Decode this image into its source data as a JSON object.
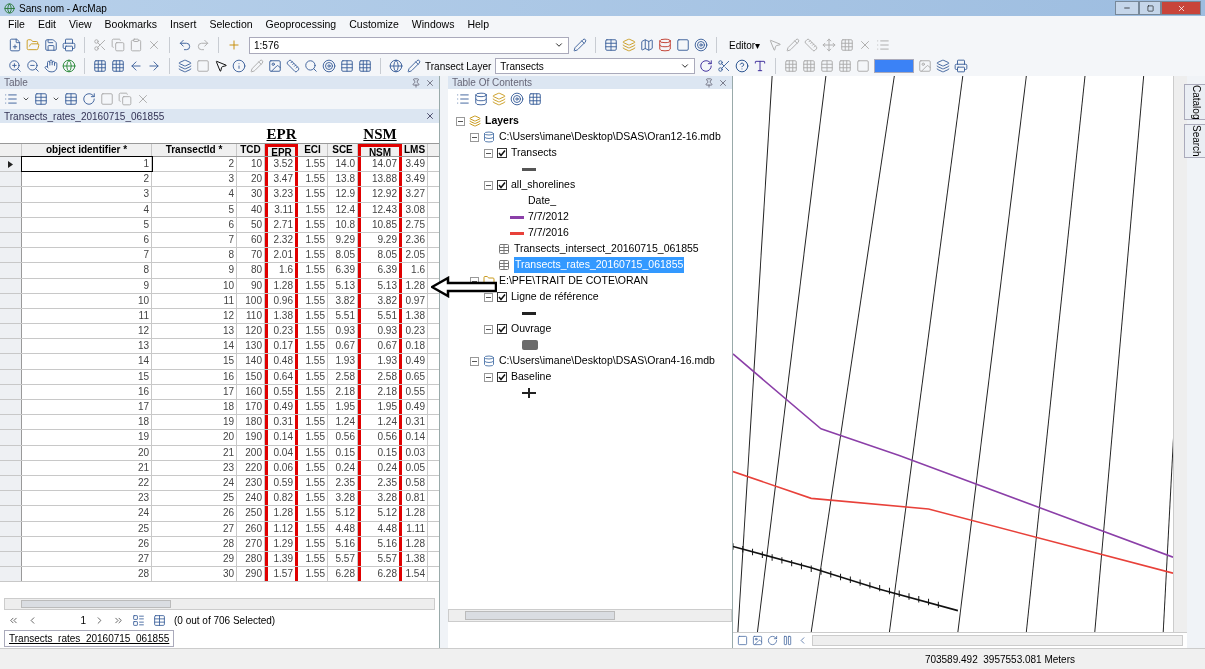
{
  "window": {
    "title": "Sans nom - ArcMap"
  },
  "menu": [
    "File",
    "Edit",
    "View",
    "Bookmarks",
    "Insert",
    "Selection",
    "Geoprocessing",
    "Customize",
    "Windows",
    "Help"
  ],
  "toolbar": {
    "scale": "1:576",
    "editor": "Editor▾",
    "transect_layer_label": "Transect Layer",
    "transect_layer_value": "Transects"
  },
  "table_panel": {
    "title": "Table",
    "table_name": "Transects_rates_20160715_061855",
    "columns": [
      {
        "label": "object identifier *",
        "highlighted": false
      },
      {
        "label": "TransectId *",
        "highlighted": false
      },
      {
        "label": "TCD",
        "highlighted": false
      },
      {
        "label": "EPR",
        "highlighted": true,
        "annotation": "EPR"
      },
      {
        "label": "ECI",
        "highlighted": false
      },
      {
        "label": "SCE",
        "highlighted": false
      },
      {
        "label": "NSM",
        "highlighted": true,
        "annotation": "NSM"
      },
      {
        "label": "LMS",
        "highlighted": false
      }
    ],
    "rows": [
      {
        "current": true,
        "cells": [
          "1",
          "2",
          "10",
          "3.52",
          "1.55",
          "14.0",
          "14.07",
          "3.49"
        ]
      },
      {
        "current": false,
        "cells": [
          "2",
          "3",
          "20",
          "3.47",
          "1.55",
          "13.8",
          "13.88",
          "3.49"
        ]
      },
      {
        "current": false,
        "cells": [
          "3",
          "4",
          "30",
          "3.23",
          "1.55",
          "12.9",
          "12.92",
          "3.27"
        ]
      },
      {
        "current": false,
        "cells": [
          "4",
          "5",
          "40",
          "3.11",
          "1.55",
          "12.4",
          "12.43",
          "3.08"
        ]
      },
      {
        "current": false,
        "cells": [
          "5",
          "6",
          "50",
          "2.71",
          "1.55",
          "10.8",
          "10.85",
          "2.75"
        ]
      },
      {
        "current": false,
        "cells": [
          "6",
          "7",
          "60",
          "2.32",
          "1.55",
          "9.29",
          "9.29",
          "2.36"
        ]
      },
      {
        "current": false,
        "cells": [
          "7",
          "8",
          "70",
          "2.01",
          "1.55",
          "8.05",
          "8.05",
          "2.05"
        ]
      },
      {
        "current": false,
        "cells": [
          "8",
          "9",
          "80",
          "1.6",
          "1.55",
          "6.39",
          "6.39",
          "1.6"
        ]
      },
      {
        "current": false,
        "cells": [
          "9",
          "10",
          "90",
          "1.28",
          "1.55",
          "5.13",
          "5.13",
          "1.28"
        ]
      },
      {
        "current": false,
        "cells": [
          "10",
          "11",
          "100",
          "0.96",
          "1.55",
          "3.82",
          "3.82",
          "0.97"
        ]
      },
      {
        "current": false,
        "cells": [
          "11",
          "12",
          "110",
          "1.38",
          "1.55",
          "5.51",
          "5.51",
          "1.38"
        ]
      },
      {
        "current": false,
        "cells": [
          "12",
          "13",
          "120",
          "0.23",
          "1.55",
          "0.93",
          "0.93",
          "0.23"
        ]
      },
      {
        "current": false,
        "cells": [
          "13",
          "14",
          "130",
          "0.17",
          "1.55",
          "0.67",
          "0.67",
          "0.18"
        ]
      },
      {
        "current": false,
        "cells": [
          "14",
          "15",
          "140",
          "0.48",
          "1.55",
          "1.93",
          "1.93",
          "0.49"
        ]
      },
      {
        "current": false,
        "cells": [
          "15",
          "16",
          "150",
          "0.64",
          "1.55",
          "2.58",
          "2.58",
          "0.65"
        ]
      },
      {
        "current": false,
        "cells": [
          "16",
          "17",
          "160",
          "0.55",
          "1.55",
          "2.18",
          "2.18",
          "0.55"
        ]
      },
      {
        "current": false,
        "cells": [
          "17",
          "18",
          "170",
          "0.49",
          "1.55",
          "1.95",
          "1.95",
          "0.49"
        ]
      },
      {
        "current": false,
        "cells": [
          "18",
          "19",
          "180",
          "0.31",
          "1.55",
          "1.24",
          "1.24",
          "0.31"
        ]
      },
      {
        "current": false,
        "cells": [
          "19",
          "20",
          "190",
          "0.14",
          "1.55",
          "0.56",
          "0.56",
          "0.14"
        ]
      },
      {
        "current": false,
        "cells": [
          "20",
          "21",
          "200",
          "0.04",
          "1.55",
          "0.15",
          "0.15",
          "0.03"
        ]
      },
      {
        "current": false,
        "cells": [
          "21",
          "23",
          "220",
          "0.06",
          "1.55",
          "0.24",
          "0.24",
          "0.05"
        ]
      },
      {
        "current": false,
        "cells": [
          "22",
          "24",
          "230",
          "0.59",
          "1.55",
          "2.35",
          "2.35",
          "0.58"
        ]
      },
      {
        "current": false,
        "cells": [
          "23",
          "25",
          "240",
          "0.82",
          "1.55",
          "3.28",
          "3.28",
          "0.81"
        ]
      },
      {
        "current": false,
        "cells": [
          "24",
          "26",
          "250",
          "1.28",
          "1.55",
          "5.12",
          "5.12",
          "1.28"
        ]
      },
      {
        "current": false,
        "cells": [
          "25",
          "27",
          "260",
          "1.12",
          "1.55",
          "4.48",
          "4.48",
          "1.11"
        ]
      },
      {
        "current": false,
        "cells": [
          "26",
          "28",
          "270",
          "1.29",
          "1.55",
          "5.16",
          "5.16",
          "1.28"
        ]
      },
      {
        "current": false,
        "cells": [
          "27",
          "29",
          "280",
          "1.39",
          "1.55",
          "5.57",
          "5.57",
          "1.38"
        ]
      },
      {
        "current": false,
        "cells": [
          "28",
          "30",
          "290",
          "1.57",
          "1.55",
          "6.28",
          "6.28",
          "1.54"
        ]
      }
    ],
    "record": "1",
    "selection": "(0 out of 706 Selected)",
    "tab": "Transects_rates_20160715_061855"
  },
  "toc": {
    "title": "Table Of Contents",
    "tree": [
      {
        "kind": "group",
        "label": "Layers",
        "expanded": true,
        "children": [
          {
            "kind": "database",
            "label": "C:\\Users\\imane\\Desktop\\DSAS\\Oran12-16.mdb",
            "expanded": true,
            "children": [
              {
                "kind": "layer",
                "label": "Transects",
                "expanded": true,
                "checked": true,
                "children": [
                  {
                    "kind": "line_symbol",
                    "color": "#555555"
                  }
                ]
              },
              {
                "kind": "layer",
                "label": "all_shorelines",
                "expanded": true,
                "checked": true,
                "children": [
                  {
                    "kind": "heading",
                    "label": "Date_"
                  },
                  {
                    "kind": "line_symbol",
                    "color": "#8b3fa8",
                    "label": "7/7/2012"
                  },
                  {
                    "kind": "line_symbol",
                    "color": "#e8413a",
                    "label": "7/7/2016"
                  }
                ]
              },
              {
                "kind": "table",
                "label": "Transects_intersect_20160715_061855",
                "selected": false
              },
              {
                "kind": "table",
                "label": "Transects_rates_20160715_061855",
                "selected": true
              }
            ]
          },
          {
            "kind": "folder",
            "label": "E:\\PFE\\TRAIT DE COTE\\ORAN",
            "expanded": true,
            "children": [
              {
                "kind": "layer",
                "label": "Ligne de référence",
                "expanded": true,
                "checked": true,
                "children": [
                  {
                    "kind": "line_symbol",
                    "color": "#222222"
                  }
                ]
              },
              {
                "kind": "layer",
                "label": "Ouvrage",
                "expanded": true,
                "checked": true,
                "children": [
                  {
                    "kind": "fill_symbol",
                    "color": "#6b6b6b"
                  }
                ]
              }
            ]
          },
          {
            "kind": "database",
            "label": "C:\\Users\\imane\\Desktop\\DSAS\\Oran4-16.mdb",
            "expanded": true,
            "children": [
              {
                "kind": "layer",
                "label": "Baseline",
                "expanded": true,
                "checked": true,
                "children": [
                  {
                    "kind": "cross_symbol",
                    "color": "#222222"
                  }
                ]
              }
            ]
          }
        ]
      }
    ]
  },
  "side_tabs": [
    "Catalog",
    "Search"
  ],
  "status_bar": {
    "coordinates": "703589.492  3957553.081 Meters"
  }
}
